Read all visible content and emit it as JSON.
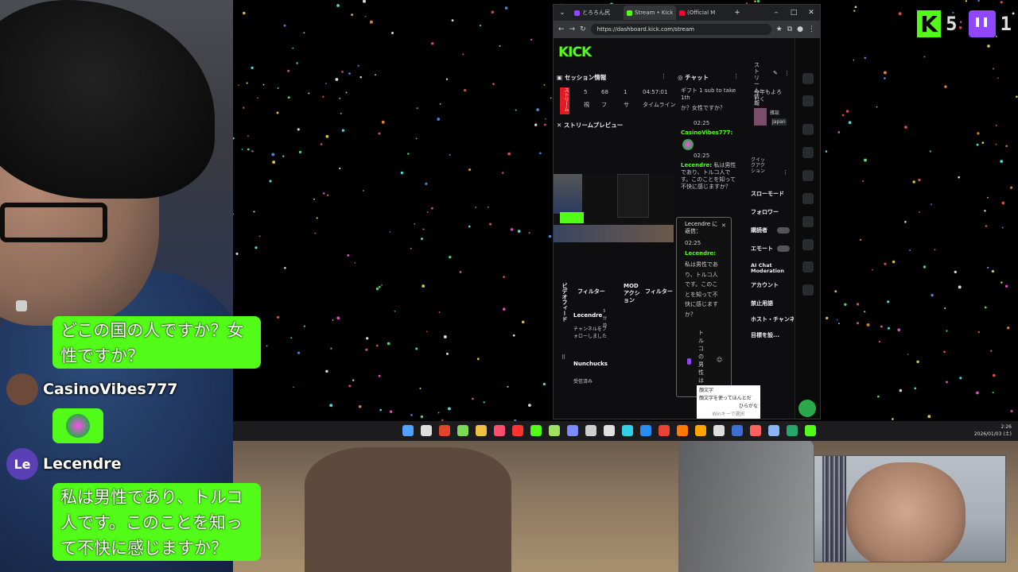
{
  "overlay": {
    "kick_count": "5",
    "twitch_count": "1",
    "chat": [
      {
        "user": "",
        "avatar_text": "",
        "avatar_color": "#444",
        "message": "どこの国の人ですか？女性ですか？"
      },
      {
        "user": "CasinoVibes777",
        "avatar_text": "",
        "avatar_color": "#6b4a3a",
        "message": ""
      },
      {
        "user": "Lecendre",
        "avatar_text": "Le",
        "avatar_color": "#5b3fb5",
        "message": "私は男性であり、トルコ人です。このことを知って不快に感じますか？"
      }
    ]
  },
  "browser": {
    "tabs": [
      {
        "label": "とろろん尻",
        "color": "#9146ff"
      },
      {
        "label": "Stream • Kick",
        "color": "#53fc18"
      },
      {
        "label": "(Official M",
        "color": "#ff0033"
      }
    ],
    "url": "https://dashboard.kick.com/stream",
    "logo": "KICK",
    "session": {
      "title": "セッション情報",
      "live_label": "ストリーム",
      "stats": [
        "5",
        "68",
        "1",
        "04:57:01"
      ],
      "stat_labels": [
        "視",
        "フ",
        "サ",
        "タイムライン"
      ]
    },
    "preview_title": "ストリームプレビュー",
    "activity": {
      "title": "ビデオフィード",
      "filter": "フィルター",
      "mod_title": "MOD アクション",
      "mod_filter": "フィルター",
      "items": [
        {
          "user": "Lecendre",
          "time": "3分前",
          "text": "チャンネルをフォローしました"
        },
        {
          "user": "Nunchucks",
          "time": "",
          "text": "受信済み"
        }
      ]
    },
    "chat": {
      "title": "チャット",
      "messages": [
        {
          "time": "",
          "user": "",
          "text": "ギフト 1 sub to take 1th"
        },
        {
          "time": "",
          "user": "",
          "text": "か？女性ですか？"
        },
        {
          "time": "02:25",
          "user": "CasinoVibes777:",
          "text": ""
        },
        {
          "time": "02:25",
          "user": "Lecendre:",
          "text": "私は男性であり、トルコ人です。このことを知って不快に感じますか？"
        }
      ],
      "reply": {
        "header": "Lecendre に返信：",
        "time": "02:25",
        "user": "Lecendre:",
        "text": "私は男性であり、トルコ人です。このことを知って不快に感じますか？",
        "draft": "トルコの男性ははほ"
      },
      "context_menu": [
        "顔文字",
        "顔文字を使ってほんとだ",
        "ひらがな",
        "Winキーで選択"
      ]
    },
    "quick_actions": {
      "title": "クイックアクション",
      "items": [
        "スローモード",
        "フォロワー",
        "購読者",
        "エモート",
        "AI Chat Moderation",
        "アカウント",
        "禁止用語",
        "ホスト・チャンネル",
        "目標を設..."
      ]
    },
    "stream_info": {
      "title": "ストリーム情報",
      "greeting": "今年もよろしく",
      "category": "雑談",
      "language": "Japan"
    }
  },
  "taskbar": {
    "time": "2:26",
    "date": "2026/01/03 (土)",
    "icon_colors": [
      "#4fa3ff",
      "#dddddd",
      "#e0452b",
      "#7ed957",
      "#f0c040",
      "#ff4d6d",
      "#ff3333",
      "#53fc18",
      "#a0e060",
      "#7c8cff",
      "#cfcfcf",
      "#e0e0e0",
      "#31d0e6",
      "#2a8bf2",
      "#ea4335",
      "#ff7a00",
      "#ffa500",
      "#dddddd",
      "#3b6fd1",
      "#ff6060",
      "#8ab4f8",
      "#29a46b",
      "#53fc18"
    ]
  },
  "colors": {
    "kick_green": "#53fc18",
    "twitch_purple": "#9146ff"
  }
}
